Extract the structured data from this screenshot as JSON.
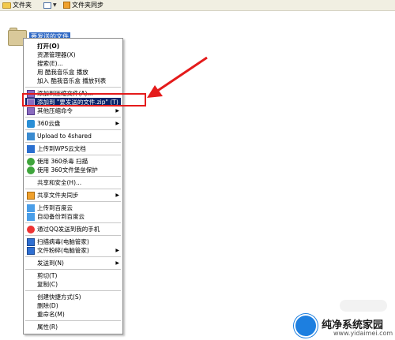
{
  "toolbar": {
    "folders_label": "文件夹",
    "sync_label": "文件夹同步"
  },
  "desktop": {
    "folder_label": "要发送的文件"
  },
  "menu": {
    "items": [
      {
        "label": "打开(O)",
        "icon": "none",
        "bold": true
      },
      {
        "label": "资源管理器(X)",
        "icon": "none"
      },
      {
        "label": "搜索(E)...",
        "icon": "none"
      },
      {
        "label": "用 酷我音乐盒 播放",
        "icon": "none"
      },
      {
        "label": "加入 酷我音乐盒 播放列表",
        "icon": "none"
      },
      {
        "label": "添加到压缩文件(A)...",
        "icon": "archive-icon"
      },
      {
        "label": "添加到 \"要发送的文件.zip\" (T)",
        "icon": "archive-icon",
        "selected": true
      },
      {
        "label": "其他压缩命令",
        "icon": "archive-icon",
        "submenu": true
      },
      {
        "label": "360云盘",
        "icon": "cloud-icon",
        "submenu": true
      },
      {
        "label": "Upload to 4shared",
        "icon": "upload-icon"
      },
      {
        "label": "上传到WPS云文档",
        "icon": "wps-icon"
      },
      {
        "label": "使用 360杀毒 扫描",
        "icon": "shield-icon"
      },
      {
        "label": "使用 360文件堡垒保护",
        "icon": "shield-icon"
      },
      {
        "label": "共享和安全(H)...",
        "icon": "none"
      },
      {
        "label": "共享文件夹同步",
        "icon": "sync-icon",
        "submenu": true
      },
      {
        "label": "上传到百度云",
        "icon": "baidu-icon"
      },
      {
        "label": "自动备份到百度云",
        "icon": "baidu-icon"
      },
      {
        "label": "通过QQ发送到我的手机",
        "icon": "qq-icon"
      },
      {
        "label": "扫描病毒(电脑管家)",
        "icon": "guard-icon"
      },
      {
        "label": "文件粉碎(电脑管家)",
        "icon": "guard-icon",
        "submenu": true
      },
      {
        "label": "发送到(N)",
        "icon": "none",
        "submenu": true
      },
      {
        "label": "剪切(T)",
        "icon": "none"
      },
      {
        "label": "复制(C)",
        "icon": "none"
      },
      {
        "label": "创建快捷方式(S)",
        "icon": "none"
      },
      {
        "label": "删除(D)",
        "icon": "none"
      },
      {
        "label": "重命名(M)",
        "icon": "none"
      },
      {
        "label": "属性(R)",
        "icon": "none"
      }
    ]
  },
  "watermark": {
    "title": "纯净系统家园",
    "url": "www.yidaimei.com"
  },
  "colors": {
    "highlight": "#e41b1b",
    "selection": "#0a246a",
    "desktop_selection": "#316ac5"
  }
}
